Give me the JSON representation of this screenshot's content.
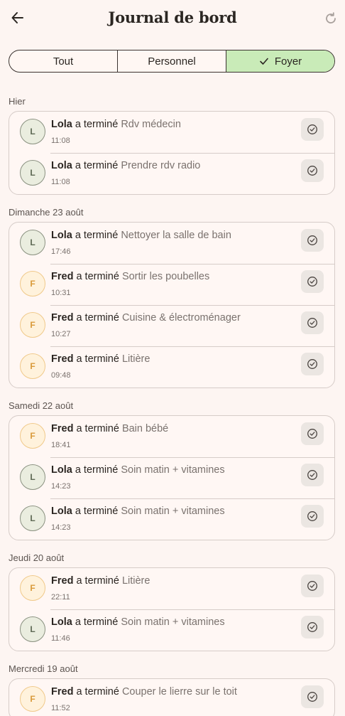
{
  "header": {
    "title": "Journal de bord",
    "back_icon": "arrow-left-icon",
    "refresh_icon": "refresh-icon"
  },
  "tabs": [
    {
      "label": "Tout",
      "active": false
    },
    {
      "label": "Personnel",
      "active": false
    },
    {
      "label": "Foyer",
      "active": true
    }
  ],
  "colors": {
    "background": "#fdf5f2",
    "active_tab": "#c9ebb8",
    "lola_avatar_bg": "#eaeddf",
    "fred_avatar_bg": "#fff2dc",
    "fred_avatar_text": "#d99a3a"
  },
  "verb": "a terminé",
  "days": [
    {
      "label": "Hier",
      "entries": [
        {
          "initial": "L",
          "user": "Lola",
          "kind": "lola",
          "task": "Rdv médecin",
          "time": "11:08"
        },
        {
          "initial": "L",
          "user": "Lola",
          "kind": "lola",
          "task": "Prendre rdv radio",
          "time": "11:08"
        }
      ]
    },
    {
      "label": "Dimanche 23 août",
      "entries": [
        {
          "initial": "L",
          "user": "Lola",
          "kind": "lola",
          "task": "Nettoyer la salle de bain",
          "time": "17:46"
        },
        {
          "initial": "F",
          "user": "Fred",
          "kind": "fred",
          "task": "Sortir les poubelles",
          "time": "10:31"
        },
        {
          "initial": "F",
          "user": "Fred",
          "kind": "fred",
          "task": "Cuisine & électroménager",
          "time": "10:27"
        },
        {
          "initial": "F",
          "user": "Fred",
          "kind": "fred",
          "task": "Litière",
          "time": "09:48"
        }
      ]
    },
    {
      "label": "Samedi 22 août",
      "entries": [
        {
          "initial": "F",
          "user": "Fred",
          "kind": "fred",
          "task": "Bain bébé",
          "time": "18:41"
        },
        {
          "initial": "L",
          "user": "Lola",
          "kind": "lola",
          "task": "Soin matin + vitamines",
          "time": "14:23"
        },
        {
          "initial": "L",
          "user": "Lola",
          "kind": "lola",
          "task": "Soin matin + vitamines",
          "time": "14:23"
        }
      ]
    },
    {
      "label": "Jeudi 20 août",
      "entries": [
        {
          "initial": "F",
          "user": "Fred",
          "kind": "fred",
          "task": "Litière",
          "time": "22:11"
        },
        {
          "initial": "L",
          "user": "Lola",
          "kind": "lola",
          "task": "Soin matin + vitamines",
          "time": "11:46"
        }
      ]
    },
    {
      "label": "Mercredi 19 août",
      "entries": [
        {
          "initial": "F",
          "user": "Fred",
          "kind": "fred",
          "task": "Couper le lierre sur le toit",
          "time": "11:52"
        }
      ]
    }
  ]
}
